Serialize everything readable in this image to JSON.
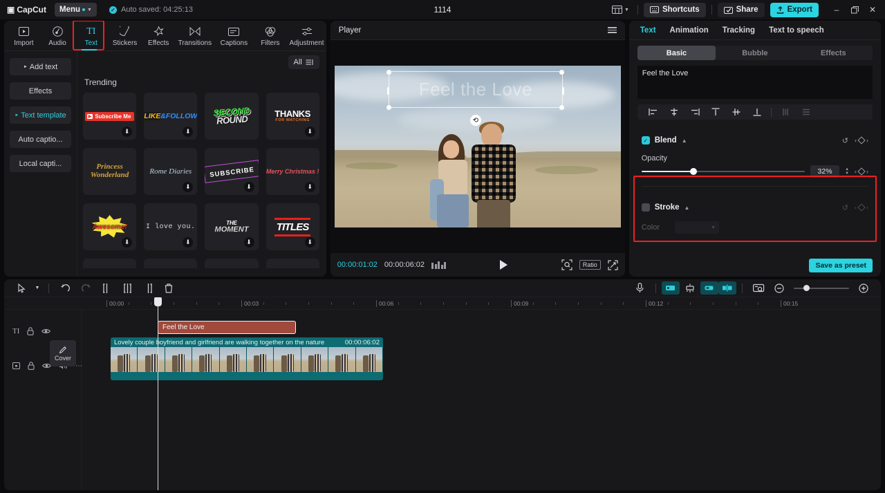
{
  "titlebar": {
    "app_name": "CapCut",
    "menu_label": "Menu",
    "autosave": "Auto saved: 04:25:13",
    "project_title": "1114",
    "shortcuts": "Shortcuts",
    "share": "Share",
    "export": "Export",
    "minimize": "–",
    "maximize": "❐",
    "close": "✕"
  },
  "tools": [
    {
      "label": "Import",
      "icon": "import-icon"
    },
    {
      "label": "Audio",
      "icon": "audio-icon"
    },
    {
      "label": "Text",
      "icon": "text-icon"
    },
    {
      "label": "Stickers",
      "icon": "stickers-icon"
    },
    {
      "label": "Effects",
      "icon": "effects-icon"
    },
    {
      "label": "Transitions",
      "icon": "transitions-icon"
    },
    {
      "label": "Captions",
      "icon": "captions-icon"
    },
    {
      "label": "Filters",
      "icon": "filters-icon"
    },
    {
      "label": "Adjustment",
      "icon": "adjustment-icon"
    }
  ],
  "subnav": [
    {
      "label": "Add text"
    },
    {
      "label": "Effects"
    },
    {
      "label": "Text template"
    },
    {
      "label": "Auto captio..."
    },
    {
      "label": "Local capti..."
    }
  ],
  "library": {
    "filter_label": "All",
    "section_title": "Trending",
    "cards": [
      {
        "name": "Subscribe Me",
        "download": true
      },
      {
        "name": "LIKE & FOLLOW",
        "download": true
      },
      {
        "name": "SECOND ROUND",
        "download": false
      },
      {
        "name": "THANKS FOR WATCHING",
        "download": true
      },
      {
        "name": "Princess Wonderland",
        "download": false
      },
      {
        "name": "Rome Diaries",
        "download": true
      },
      {
        "name": "SUBSCRIBE",
        "download": true
      },
      {
        "name": "Merry Christmas !",
        "download": true
      },
      {
        "name": "Awesome!",
        "download": true
      },
      {
        "name": "I love you.",
        "download": true
      },
      {
        "name": "THE MOMENT",
        "download": true
      },
      {
        "name": "TITLES",
        "download": true
      }
    ],
    "card_labels": {
      "subscribe_me": "Subscribe Me",
      "like": "LIKE",
      "amp_follow": "&FOLLOW",
      "second": "SECOND",
      "round": "ROUND",
      "thanks": "THANKS",
      "for_watching": "FOR WATCHING",
      "princess": "Princess",
      "wonderland": "Wonderland",
      "rome_diaries": "Rome Diaries",
      "subscribe": "SUBSCRIBE",
      "merry_christmas": "Merry Christmas !",
      "awesome": "Awesome!",
      "i_love_you": "I love you.",
      "the": "THE",
      "moment": "MOMENT",
      "titles": "TITLES"
    }
  },
  "player": {
    "title": "Player",
    "overlay_text": "Feel the Love",
    "current_time": "00:00:01:02",
    "total_time": "00:00:06:02",
    "ratio_label": "Ratio"
  },
  "right_panel": {
    "tabs": [
      "Text",
      "Animation",
      "Tracking",
      "Text to speech"
    ],
    "segments": [
      "Basic",
      "Bubble",
      "Effects"
    ],
    "text_value": "Feel the Love",
    "blend": {
      "title": "Blend",
      "enabled": true,
      "opacity_label": "Opacity",
      "opacity_value": "32%",
      "opacity_percent": 32
    },
    "stroke": {
      "title": "Stroke",
      "enabled": false,
      "color_label": "Color"
    },
    "save_preset": "Save as preset"
  },
  "timeline": {
    "ruler_labels": [
      "00:00",
      "00:03",
      "00:06",
      "00:09",
      "00:12",
      "00:15"
    ],
    "text_clip": {
      "label": "Feel the Love"
    },
    "video_clip": {
      "label": "Lovely couple boyfriend and girlfriend are walking together on the nature",
      "duration": "00:00:06:02"
    },
    "cover_label": "Cover",
    "track_head_text_icon": "text-track-icon",
    "track_head_video_icon": "video-track-icon"
  },
  "colors": {
    "accent": "#2dd0de",
    "export": "#2cd3e1",
    "highlight": "#f02020",
    "clip_text": "#a0493c",
    "clip_video": "#0d6b72"
  }
}
